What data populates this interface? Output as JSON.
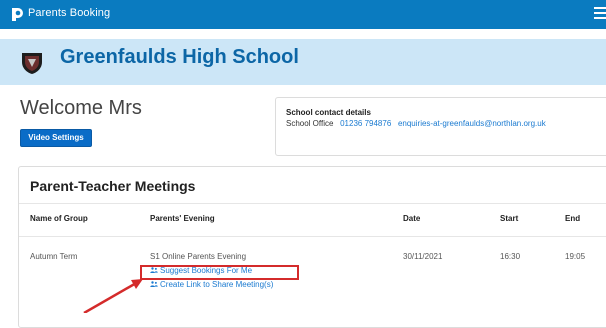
{
  "app": {
    "name": "Parents Booking",
    "logo_icon": "parents-booking-logo-icon",
    "menu_icon": "hamburger-menu-icon",
    "brand_color": "#0a7bc0"
  },
  "banner": {
    "school_name": "Greenfaulds High School",
    "crest_icon": "school-crest-icon",
    "background": "#cce6f7"
  },
  "welcome": {
    "text": "Welcome Mrs",
    "video_button": "Video Settings"
  },
  "contact": {
    "title": "School contact details",
    "office_label": "School Office",
    "phone": "01236 794876",
    "email": "enquiries-at-greenfaulds@northlan.org.uk"
  },
  "meetings": {
    "heading": "Parent-Teacher Meetings",
    "columns": [
      "Name of Group",
      "Parents' Evening",
      "Date",
      "Start",
      "End"
    ],
    "rows": [
      {
        "group": "Autumn Term",
        "evening": "S1 Online Parents Evening",
        "date": "30/11/2021",
        "start": "16:30",
        "end": "19:05",
        "actions": [
          {
            "label": "Suggest Bookings For Me",
            "icon": "people-icon"
          },
          {
            "label": "Create Link to Share Meeting(s)",
            "icon": "people-icon"
          }
        ]
      }
    ]
  },
  "annotation": {
    "color": "#d42b2b"
  }
}
